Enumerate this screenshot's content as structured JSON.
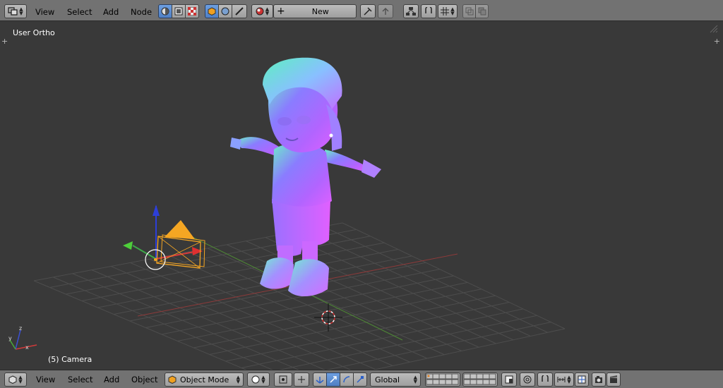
{
  "header_top": {
    "menus": [
      "View",
      "Select",
      "Add",
      "Node"
    ],
    "new_label": "New"
  },
  "viewport": {
    "view_label": "User Ortho",
    "object_label": "(5) Camera"
  },
  "header_bottom": {
    "menus": [
      "View",
      "Select",
      "Add",
      "Object"
    ],
    "mode_label": "Object Mode",
    "orientation_label": "Global"
  },
  "colors": {
    "header_bg": "#727272",
    "viewport_bg": "#393939",
    "grid": "#505050",
    "x_axis": "#a03a3a",
    "y_axis": "#5f9a3a",
    "camera": "#f5a623"
  }
}
